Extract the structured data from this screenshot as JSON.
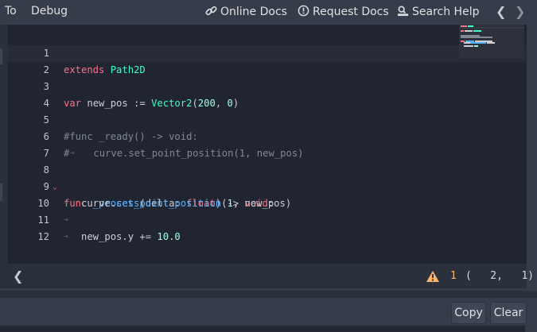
{
  "menu": {
    "go_to_label": "To",
    "debug_label": "Debug",
    "online_docs_label": "Online Docs",
    "request_docs_label": "Request Docs",
    "search_help_label": "Search Help"
  },
  "nav": {
    "prev_glyph": "❮",
    "next_glyph": "❯"
  },
  "editor": {
    "lines": [
      {
        "num": "1"
      },
      {
        "num": "2"
      },
      {
        "num": "3"
      },
      {
        "num": "4"
      },
      {
        "num": "5"
      },
      {
        "num": "6"
      },
      {
        "num": "7"
      },
      {
        "num": "8"
      },
      {
        "num": "9"
      },
      {
        "num": "10"
      },
      {
        "num": "11"
      },
      {
        "num": "12"
      }
    ],
    "code": {
      "l1": {
        "kw": "extends",
        "ty": "Path2D"
      },
      "l3": {
        "kw": "var",
        "var": " new_pos := ",
        "ty": "Vector2",
        "open": "(",
        "n1": "200",
        "sep": ", ",
        "n2": "0",
        "close": ")"
      },
      "l5": {
        "comment": "#func _ready() -> void:"
      },
      "l6": {
        "hash": "#",
        "tab": "⇥",
        "comment": "   curve.set_point_position(1, new_pos)"
      },
      "l8": {
        "kw": "func",
        "fn": " _process",
        "open": "(delta: ",
        "ty": "float",
        "close": ") -> ",
        "ret": "void",
        "colon": ":"
      },
      "l9": {
        "tab": "⇥",
        "obj": "   curve.",
        "fn": "set_point_position",
        "open": "(",
        "n": "1",
        "rest": ", new_pos)"
      },
      "l10": {
        "tab": "⇥"
      },
      "l11": {
        "tab": "⇥",
        "expr": "   new_pos.y += ",
        "n": "10.0"
      }
    },
    "fold_glyph": "⌄"
  },
  "status": {
    "collapse_glyph": "❮",
    "warning_count": "1",
    "position": "(   2,   1)"
  },
  "output": {
    "copy_label": "Copy",
    "clear_label": "Clear"
  },
  "icons": [
    "link-icon",
    "help-icon",
    "doc-search-icon",
    "warning-icon"
  ],
  "colors": {
    "editor_bg": "#202531",
    "keyword": "#ff7085",
    "type": "#42ffc2",
    "number": "#a1ffe0",
    "comment": "#818793",
    "function": "#57b3ff",
    "warning": "#ffb36b"
  }
}
